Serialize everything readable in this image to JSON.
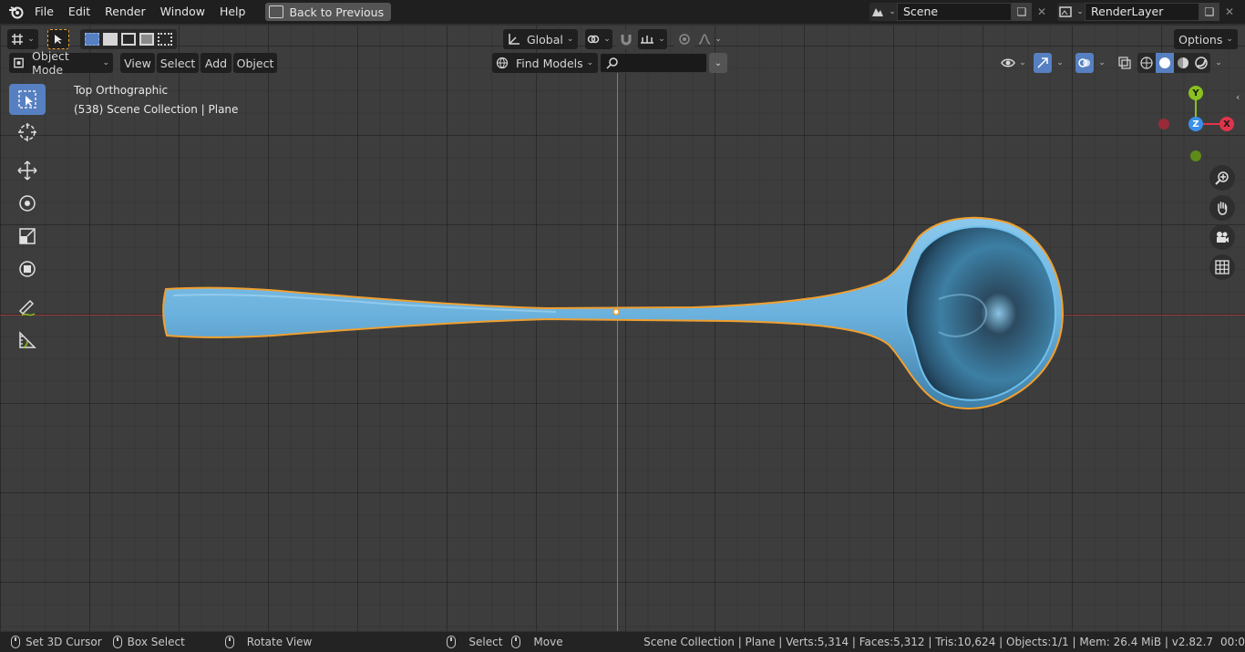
{
  "menubar": {
    "items": [
      "File",
      "Edit",
      "Render",
      "Window",
      "Help"
    ],
    "back_button": "Back to Previous",
    "scene_name": "Scene",
    "render_layer": "RenderLayer"
  },
  "header": {
    "transform_orientation": "Global",
    "options_label": "Options",
    "mode": "Object Mode",
    "menus": [
      "View",
      "Select",
      "Add",
      "Object"
    ],
    "find_models": "Find Models",
    "search_placeholder": ""
  },
  "viewport": {
    "view_name": "Top Orthographic",
    "collection_info": "(538) Scene Collection | Plane",
    "gizmo": {
      "y": "Y",
      "z": "Z",
      "x": "X"
    }
  },
  "statusbar": {
    "set_cursor": "Set 3D Cursor",
    "box_select": "Box Select",
    "rotate_view": "Rotate View",
    "select": "Select",
    "move": "Move",
    "stats": "Scene Collection | Plane | Verts:5,314 | Faces:5,312 | Tris:10,624 | Objects:1/1 | Mem: 26.4 MiB | v2.82.7",
    "time": "00:0"
  },
  "colors": {
    "accent": "#5680c2",
    "selection_outline": "#f0a030",
    "spoon": "#6fb5e0",
    "gizmo_x": "#e0344a",
    "gizmo_y": "#8ac020",
    "gizmo_z": "#3a90e8"
  }
}
